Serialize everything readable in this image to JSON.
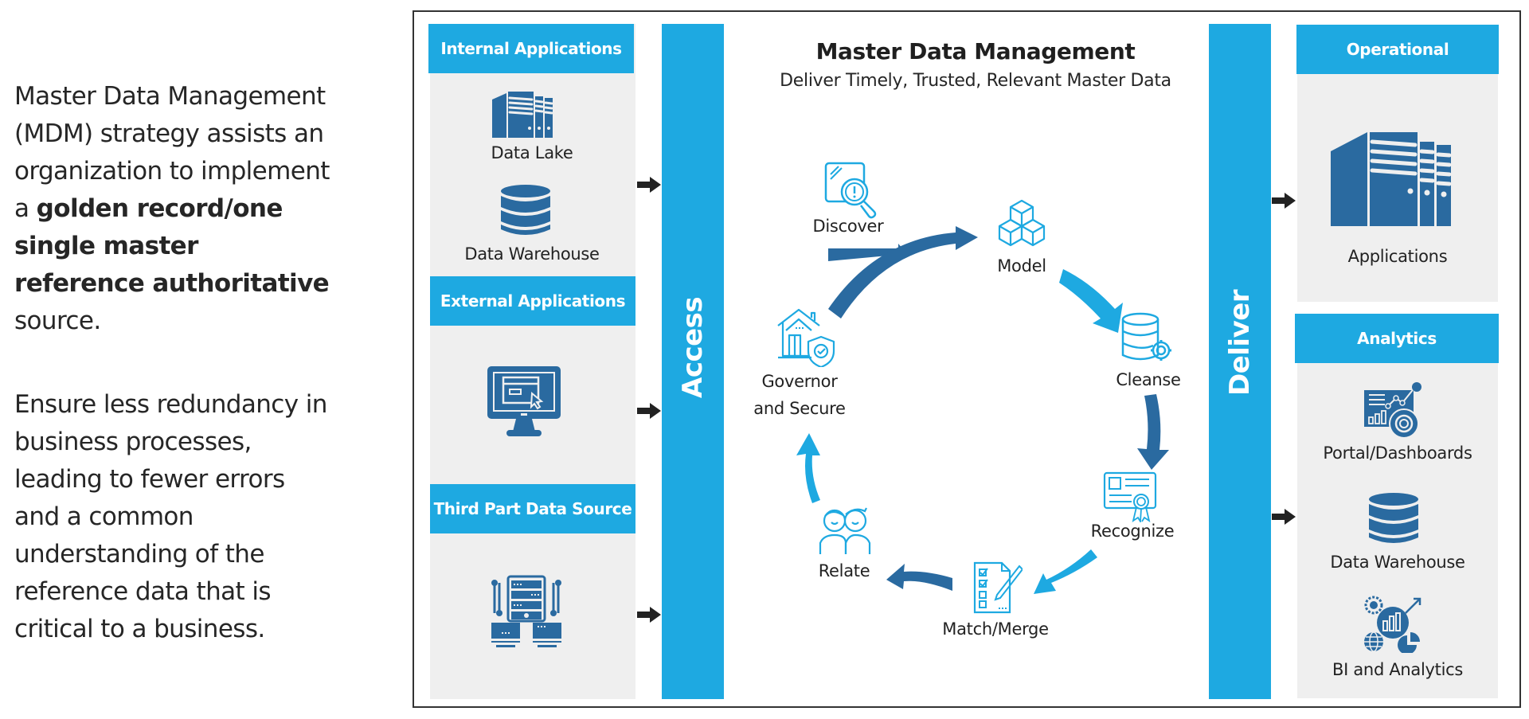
{
  "intro": {
    "p1_a": "Master Data Management (MDM) strategy assists an organization to implement a ",
    "p1_bold": "golden record/one single master reference authoritative",
    "p1_b": " source.",
    "p2": "Ensure less redundancy in business processes, leading to fewer errors and a common understanding of the reference data that is critical to a business."
  },
  "colors": {
    "accent": "#1ea9e1",
    "dark_blue": "#2a6aa0",
    "panel_bg": "#efefef",
    "text": "#222222"
  },
  "sources": {
    "internal": {
      "header": "Internal Applications",
      "items": [
        {
          "label": "Data Lake",
          "icon": "building-server-icon"
        },
        {
          "label": "Data Warehouse",
          "icon": "database-icon"
        }
      ]
    },
    "external": {
      "header": "External Applications",
      "items": [
        {
          "label": "",
          "icon": "monitor-click-icon"
        }
      ]
    },
    "third_party": {
      "header": "Third Part Data Source",
      "items": [
        {
          "label": "",
          "icon": "server-network-icon"
        }
      ]
    }
  },
  "access_label": "Access",
  "deliver_label": "Deliver",
  "center": {
    "title": "Master Data Management",
    "subtitle": "Deliver Timely, Trusted, Relevant Master Data",
    "cycle": [
      {
        "label": "Discover",
        "icon": "magnifier-alert-icon"
      },
      {
        "label": "Model",
        "icon": "cubes-icon"
      },
      {
        "label": "Cleanse",
        "icon": "database-gear-icon"
      },
      {
        "label": "Recognize",
        "icon": "certificate-icon"
      },
      {
        "label": "Match/Merge",
        "icon": "checklist-pen-icon"
      },
      {
        "label": "Relate",
        "icon": "people-icon"
      },
      {
        "label": "Governor\nand Secure",
        "label_line1": "Governor",
        "label_line2": "and Secure",
        "icon": "house-shield-icon"
      }
    ]
  },
  "targets": {
    "operational": {
      "header": "Operational",
      "items": [
        {
          "label": "Applications",
          "icon": "building-server-icon"
        }
      ]
    },
    "analytics": {
      "header": "Analytics",
      "items": [
        {
          "label": "Portal/Dashboards",
          "icon": "dashboard-icon"
        },
        {
          "label": "Data Warehouse",
          "icon": "database-icon"
        },
        {
          "label": "BI and Analytics",
          "icon": "bi-analytics-icon"
        }
      ]
    }
  }
}
